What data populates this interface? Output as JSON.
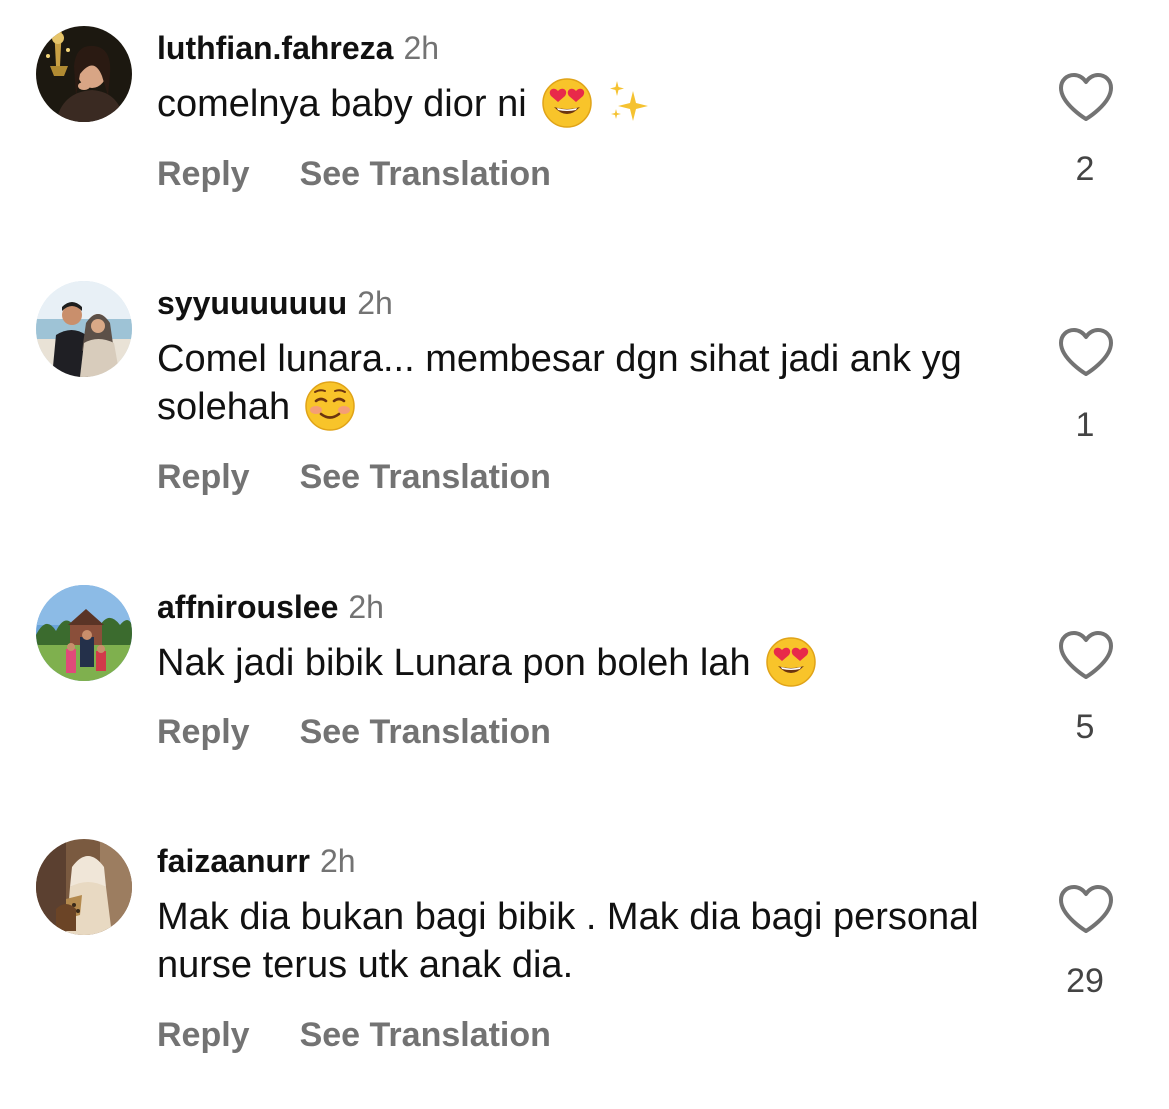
{
  "comments": [
    {
      "username": "luthfian.fahreza",
      "time": "2h",
      "text": "comelnya baby dior ni",
      "emojis": [
        "heart-eyes-emoji",
        "sparkles-emoji"
      ],
      "reply_label": "Reply",
      "translate_label": "See Translation",
      "likes": "2"
    },
    {
      "username": "syyuuuuuuu",
      "time": "2h",
      "text": "Comel lunara... membesar dgn sihat jadi ank yg solehah",
      "emojis": [
        "smiling-face-emoji"
      ],
      "reply_label": "Reply",
      "translate_label": "See Translation",
      "likes": "1"
    },
    {
      "username": "affnirouslee",
      "time": "2h",
      "text": "Nak jadi bibik Lunara pon boleh lah",
      "emojis": [
        "heart-eyes-emoji"
      ],
      "reply_label": "Reply",
      "translate_label": "See Translation",
      "likes": "5"
    },
    {
      "username": "faizaanurr",
      "time": "2h",
      "text": "Mak dia bukan bagi bibik . Mak dia bagi personal nurse terus utk anak dia.",
      "emojis": [],
      "reply_label": "Reply",
      "translate_label": "See Translation",
      "likes": "29"
    }
  ],
  "colors": {
    "text": "#111111",
    "muted": "#737373",
    "emoji_yellow": "#f8c42a",
    "heart_red": "#e8294a"
  },
  "icons": {
    "like": "heart-outline-icon"
  }
}
